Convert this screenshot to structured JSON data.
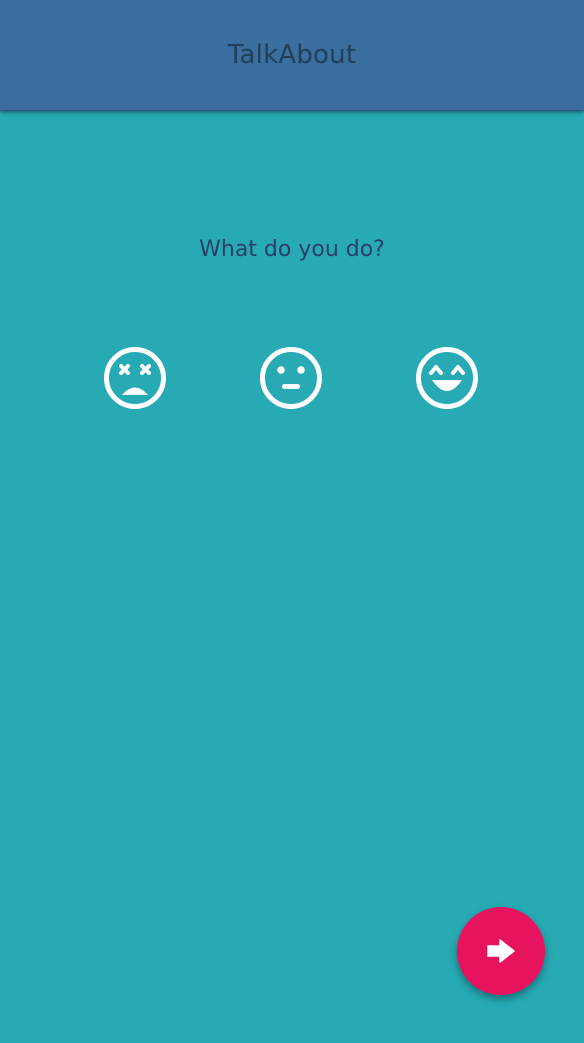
{
  "app_bar": {
    "title": "TalkAbout"
  },
  "prompt": {
    "question": "What do you do?"
  },
  "moods": [
    {
      "icon": "dizzy-face-icon"
    },
    {
      "icon": "neutral-face-icon"
    },
    {
      "icon": "grinning-face-icon"
    }
  ],
  "fab": {
    "icon": "arrow-right-icon"
  },
  "colors": {
    "background": "#27aab3",
    "app_bar": "#3b6d9f",
    "title_text": "#1f3f5a",
    "question_text": "#2b3f66",
    "icon_white": "#ffffff",
    "fab_accent": "#e8135e"
  }
}
